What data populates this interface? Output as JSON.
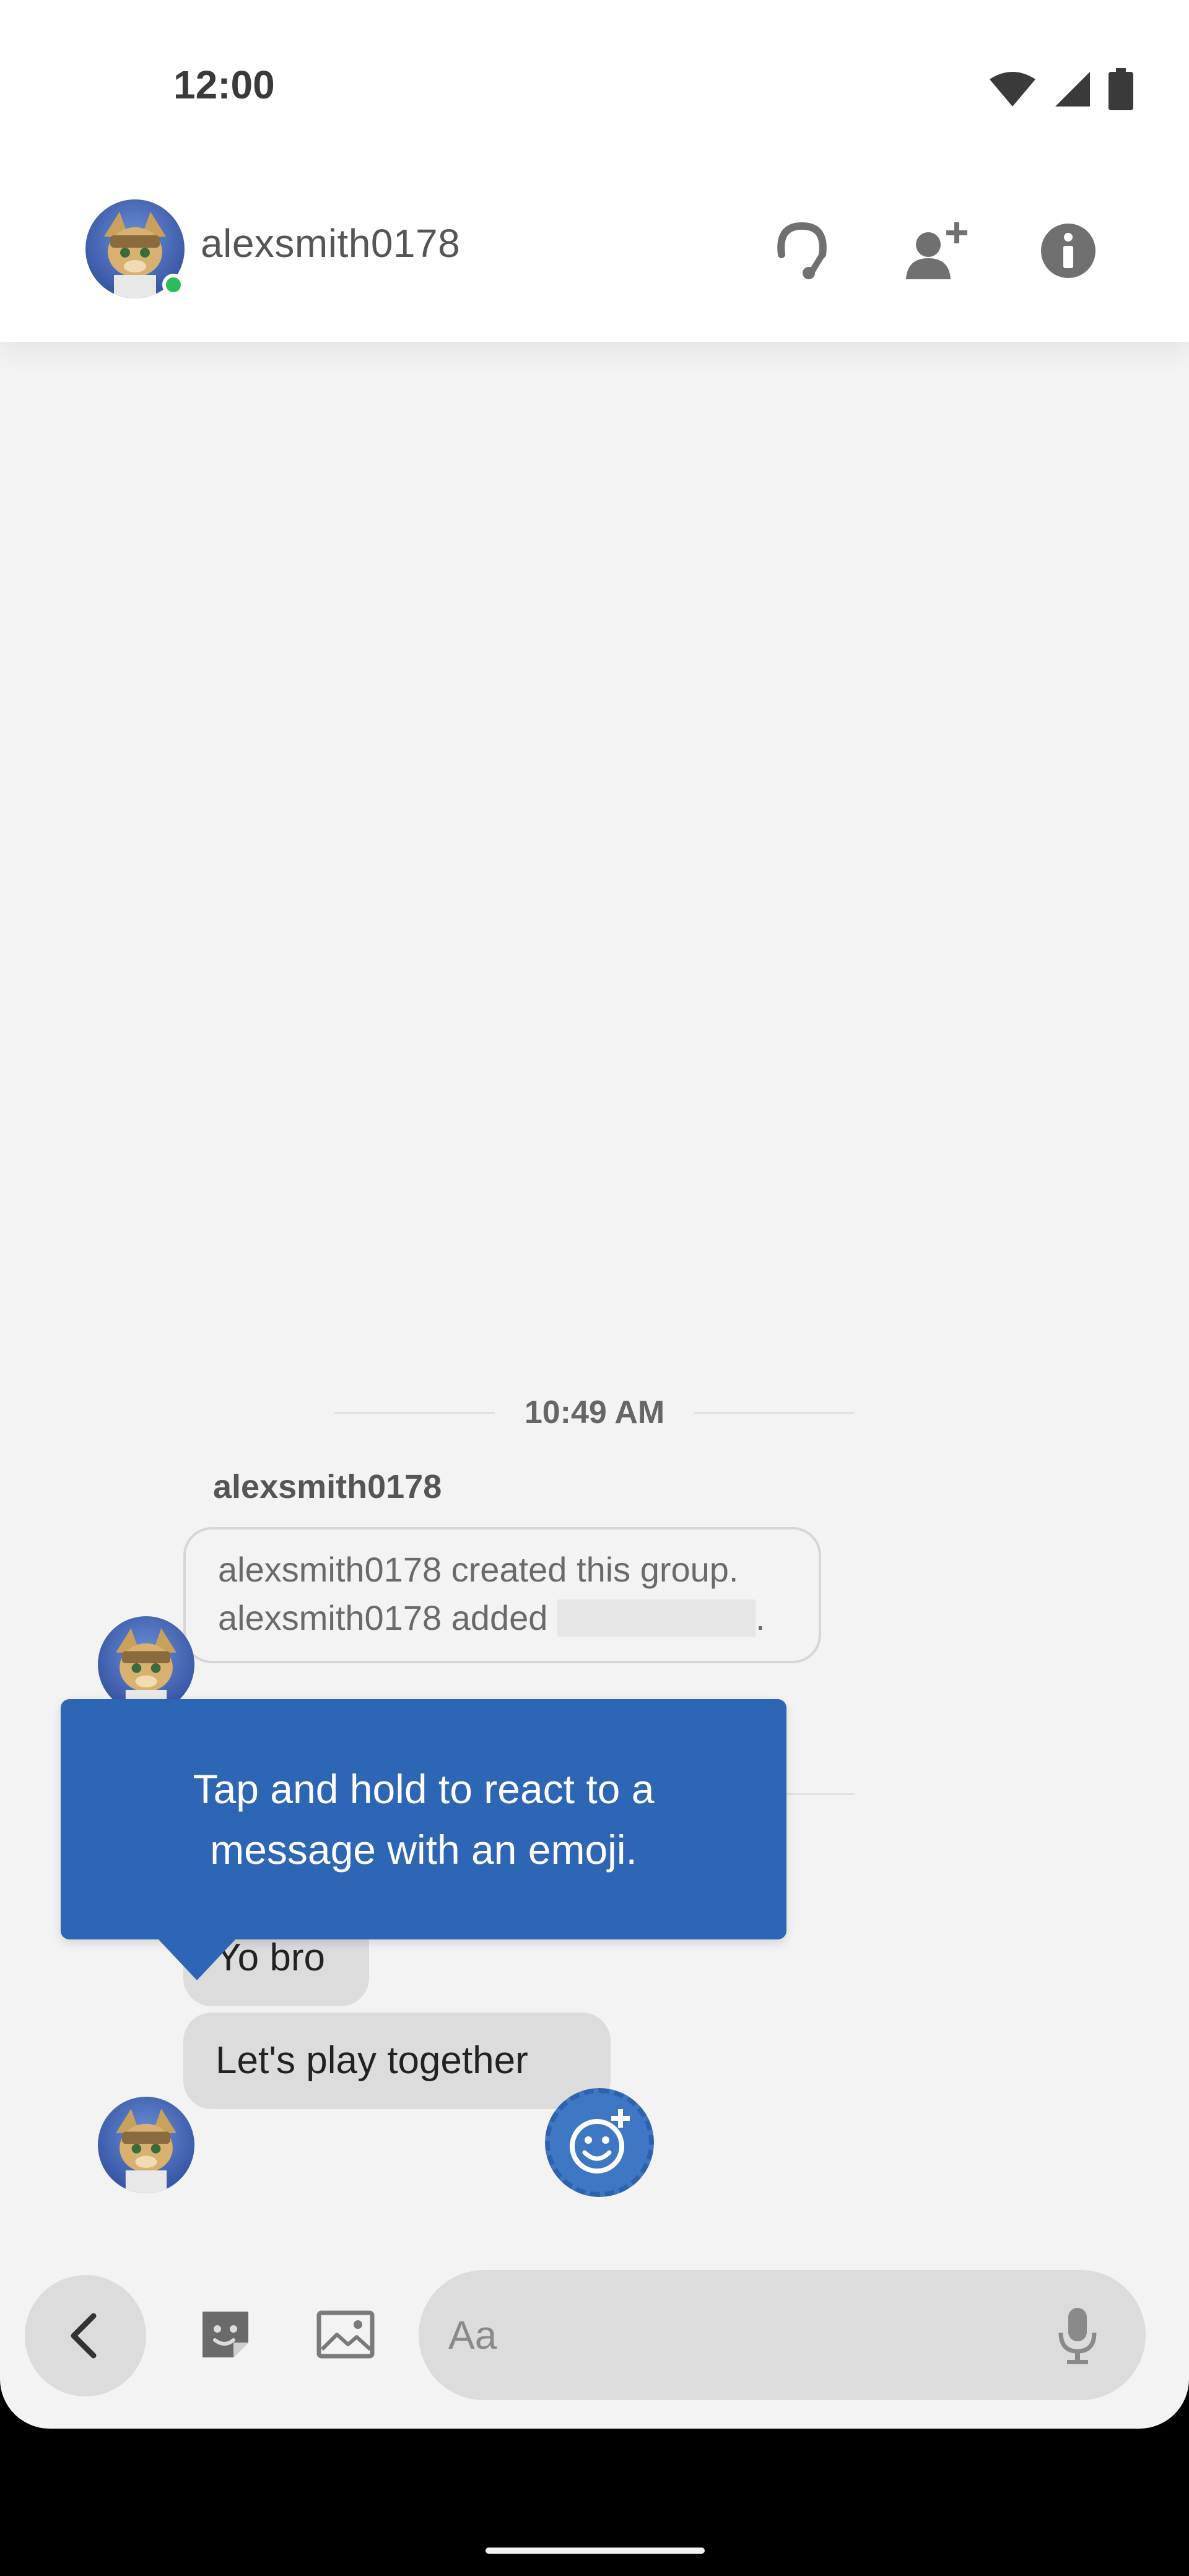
{
  "status_bar": {
    "time": "12:00",
    "icons": [
      "wifi-icon",
      "cellular-signal-icon",
      "battery-icon"
    ]
  },
  "header": {
    "username": "alexsmith0178",
    "online": true,
    "actions": [
      "voice-chat-icon",
      "add-user-icon",
      "info-icon"
    ]
  },
  "conversation": {
    "timestamp": "10:49 AM",
    "sender": "alexsmith0178",
    "system_message": {
      "line1": "alexsmith0178 created this group.",
      "line2_prefix": "alexsmith0178 added ",
      "line2_suffix": "."
    },
    "messages": [
      {
        "text": "Yo bro"
      },
      {
        "text": "Let's play together"
      }
    ]
  },
  "tooltip": {
    "text": "Tap and hold to react to a message with an emoji."
  },
  "composer": {
    "placeholder": "Aa",
    "tools": [
      "back-icon",
      "sticker-icon",
      "image-icon",
      "microphone-icon"
    ]
  },
  "colors": {
    "accent": "#2d66b5",
    "online": "#2bbd5a",
    "bubble": "#dcdcdc",
    "background": "#f3f3f3"
  }
}
